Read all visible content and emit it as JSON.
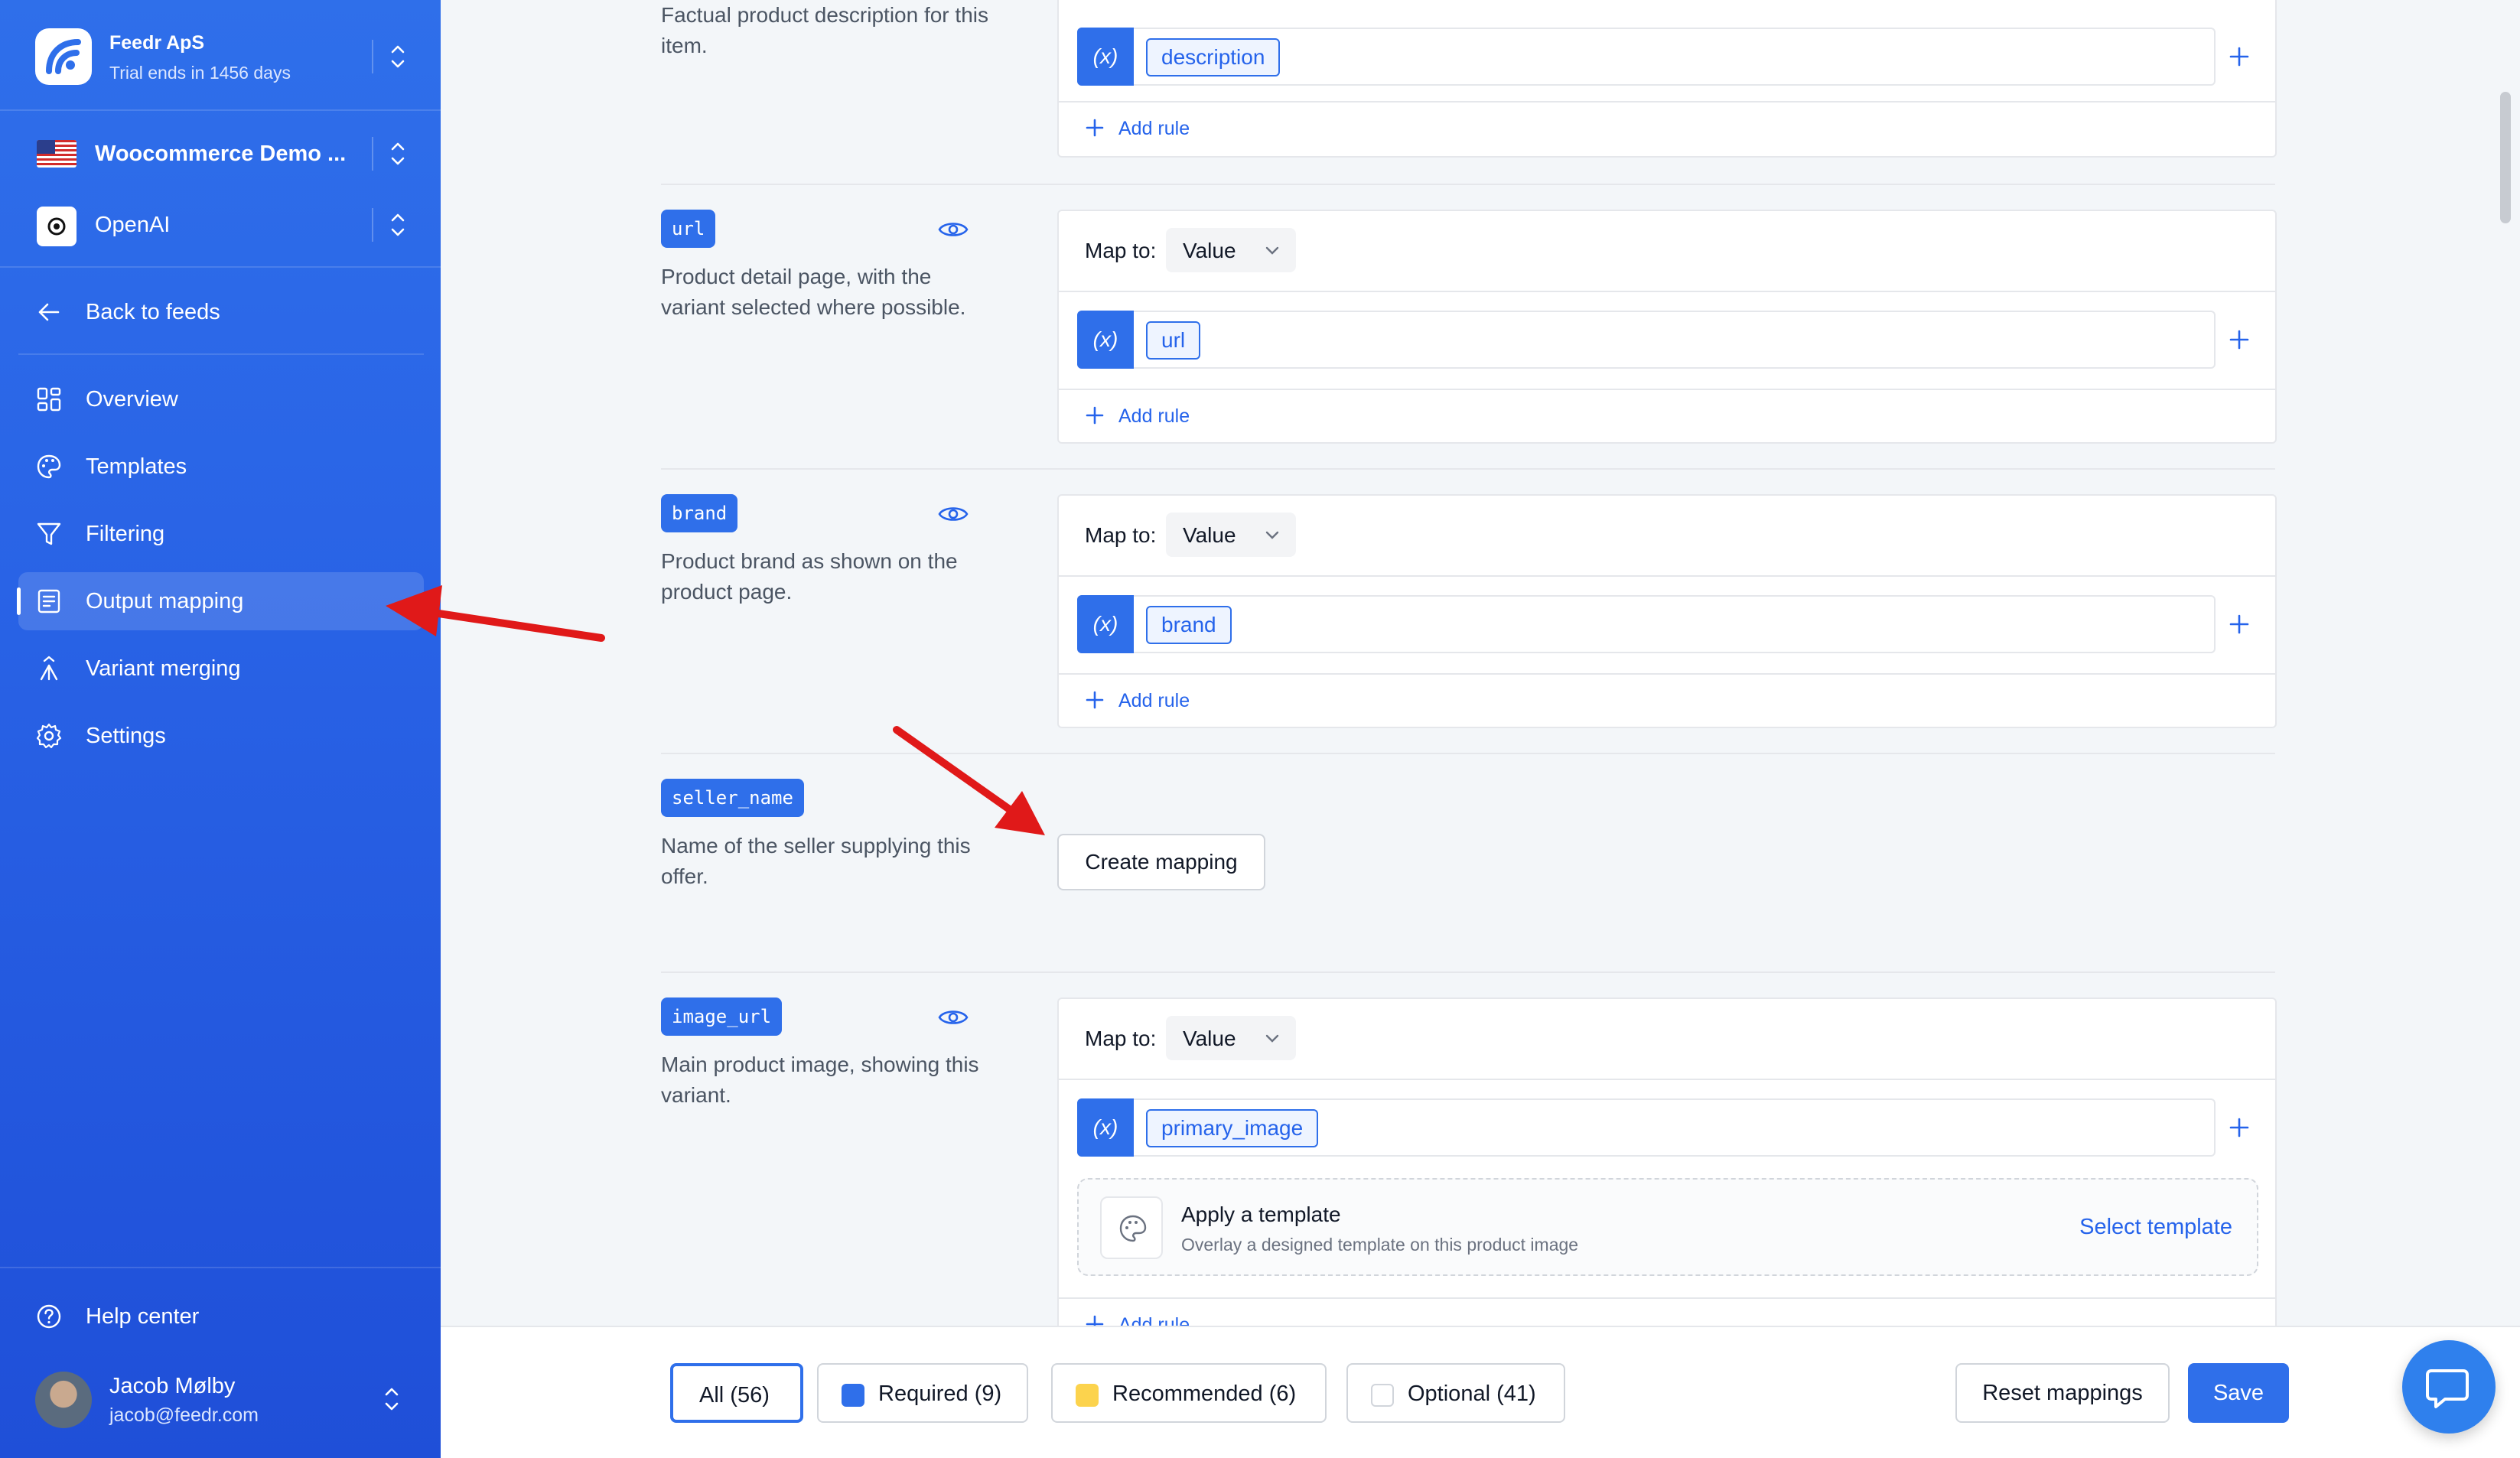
{
  "org": {
    "name": "Feedr ApS",
    "trial": "Trial ends in 1456 days"
  },
  "selectors": {
    "feed": "Woocommerce Demo ...",
    "channel": "OpenAI"
  },
  "nav": {
    "back": "Back to feeds",
    "items": [
      {
        "label": "Overview",
        "icon": "grid-icon"
      },
      {
        "label": "Templates",
        "icon": "palette-icon"
      },
      {
        "label": "Filtering",
        "icon": "filter-icon"
      },
      {
        "label": "Output mapping",
        "icon": "document-icon",
        "active": true
      },
      {
        "label": "Variant merging",
        "icon": "merge-icon"
      },
      {
        "label": "Settings",
        "icon": "gear-icon"
      }
    ],
    "help": "Help center"
  },
  "user": {
    "name": "Jacob Mølby",
    "email": "jacob@feedr.com"
  },
  "mapping": {
    "map_to_label": "Map to:",
    "map_to_value": "Value",
    "add_rule": "Add rule",
    "variable_icon": "(x)",
    "fields": [
      {
        "desc": "Factual product description for this item.",
        "variable": "description"
      },
      {
        "tag": "url",
        "desc": "Product detail page, with the variant selected where possible.",
        "variable": "url"
      },
      {
        "tag": "brand",
        "desc": "Product brand as shown on the product page.",
        "variable": "brand"
      },
      {
        "tag": "seller_name",
        "desc": "Name of the seller supplying this offer.",
        "action": "Create mapping"
      },
      {
        "tag": "image_url",
        "desc": "Main product image, showing this variant.",
        "variable": "primary_image"
      }
    ],
    "template": {
      "title": "Apply a template",
      "subtitle": "Overlay a designed template on this product image",
      "action": "Select template"
    }
  },
  "filters": {
    "all": "All (56)",
    "required": "Required (9)",
    "recommended": "Recommended (6)",
    "optional": "Optional (41)"
  },
  "colors": {
    "required": "#2f6fea",
    "recommended": "#fcd34d",
    "accent": "#2f6fea"
  },
  "actions": {
    "reset": "Reset mappings",
    "save": "Save"
  }
}
